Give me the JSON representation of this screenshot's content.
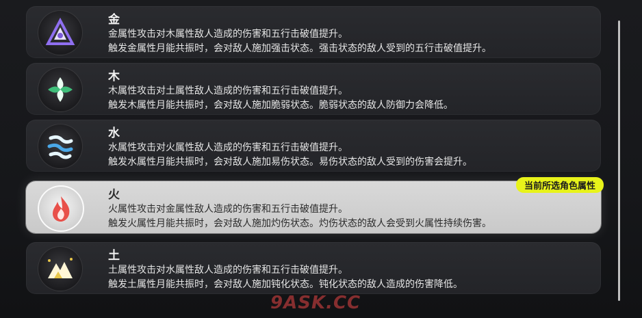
{
  "elements": [
    {
      "name": "金",
      "line1": "金属性攻击对木属性敌人造成的伤害和五行击破值提升。",
      "line2": "触发金属性月能共振时，会对敌人施加强击状态。强击状态的敌人受到的五行击破值提升。",
      "icon": "metal-triangle-icon",
      "color": "#7b5bd6"
    },
    {
      "name": "木",
      "line1": "木属性攻击对土属性敌人造成的伤害和五行击破值提升。",
      "line2": "触发木属性月能共振时，会对敌人施加脆弱状态。脆弱状态的敌人防御力会降低。",
      "icon": "wood-leaf-icon",
      "color": "#3fbf7a"
    },
    {
      "name": "水",
      "line1": "水属性攻击对火属性敌人造成的伤害和五行击破值提升。",
      "line2": "触发水属性月能共振时，会对敌人施加易伤状态。易伤状态的敌人受到的伤害会提升。",
      "icon": "water-wave-icon",
      "color": "#4aa8e8"
    },
    {
      "name": "火",
      "line1": "火属性攻击对金属性敌人造成的伤害和五行击破值提升。",
      "line2": "触发火属性月能共振时，会对敌人施加灼伤状态。灼伤状态的敌人会受到火属性持续伤害。",
      "icon": "fire-flame-icon",
      "color": "#e8504a",
      "selected": true,
      "badge": "当前所选角色属性"
    },
    {
      "name": "土",
      "line1": "土属性攻击对水属性敌人造成的伤害和五行击破值提升。",
      "line2": "触发土属性月能共振时，会对敌人施加钝化状态。钝化状态的敌人造成的伤害降低。",
      "icon": "earth-mountain-icon",
      "color": "#e8c64a"
    }
  ],
  "watermark": "9ASK.CC",
  "colors": {
    "badge": "#e8f31a",
    "card": "#2a2b2f",
    "selected_card": "#d4d4d4"
  }
}
